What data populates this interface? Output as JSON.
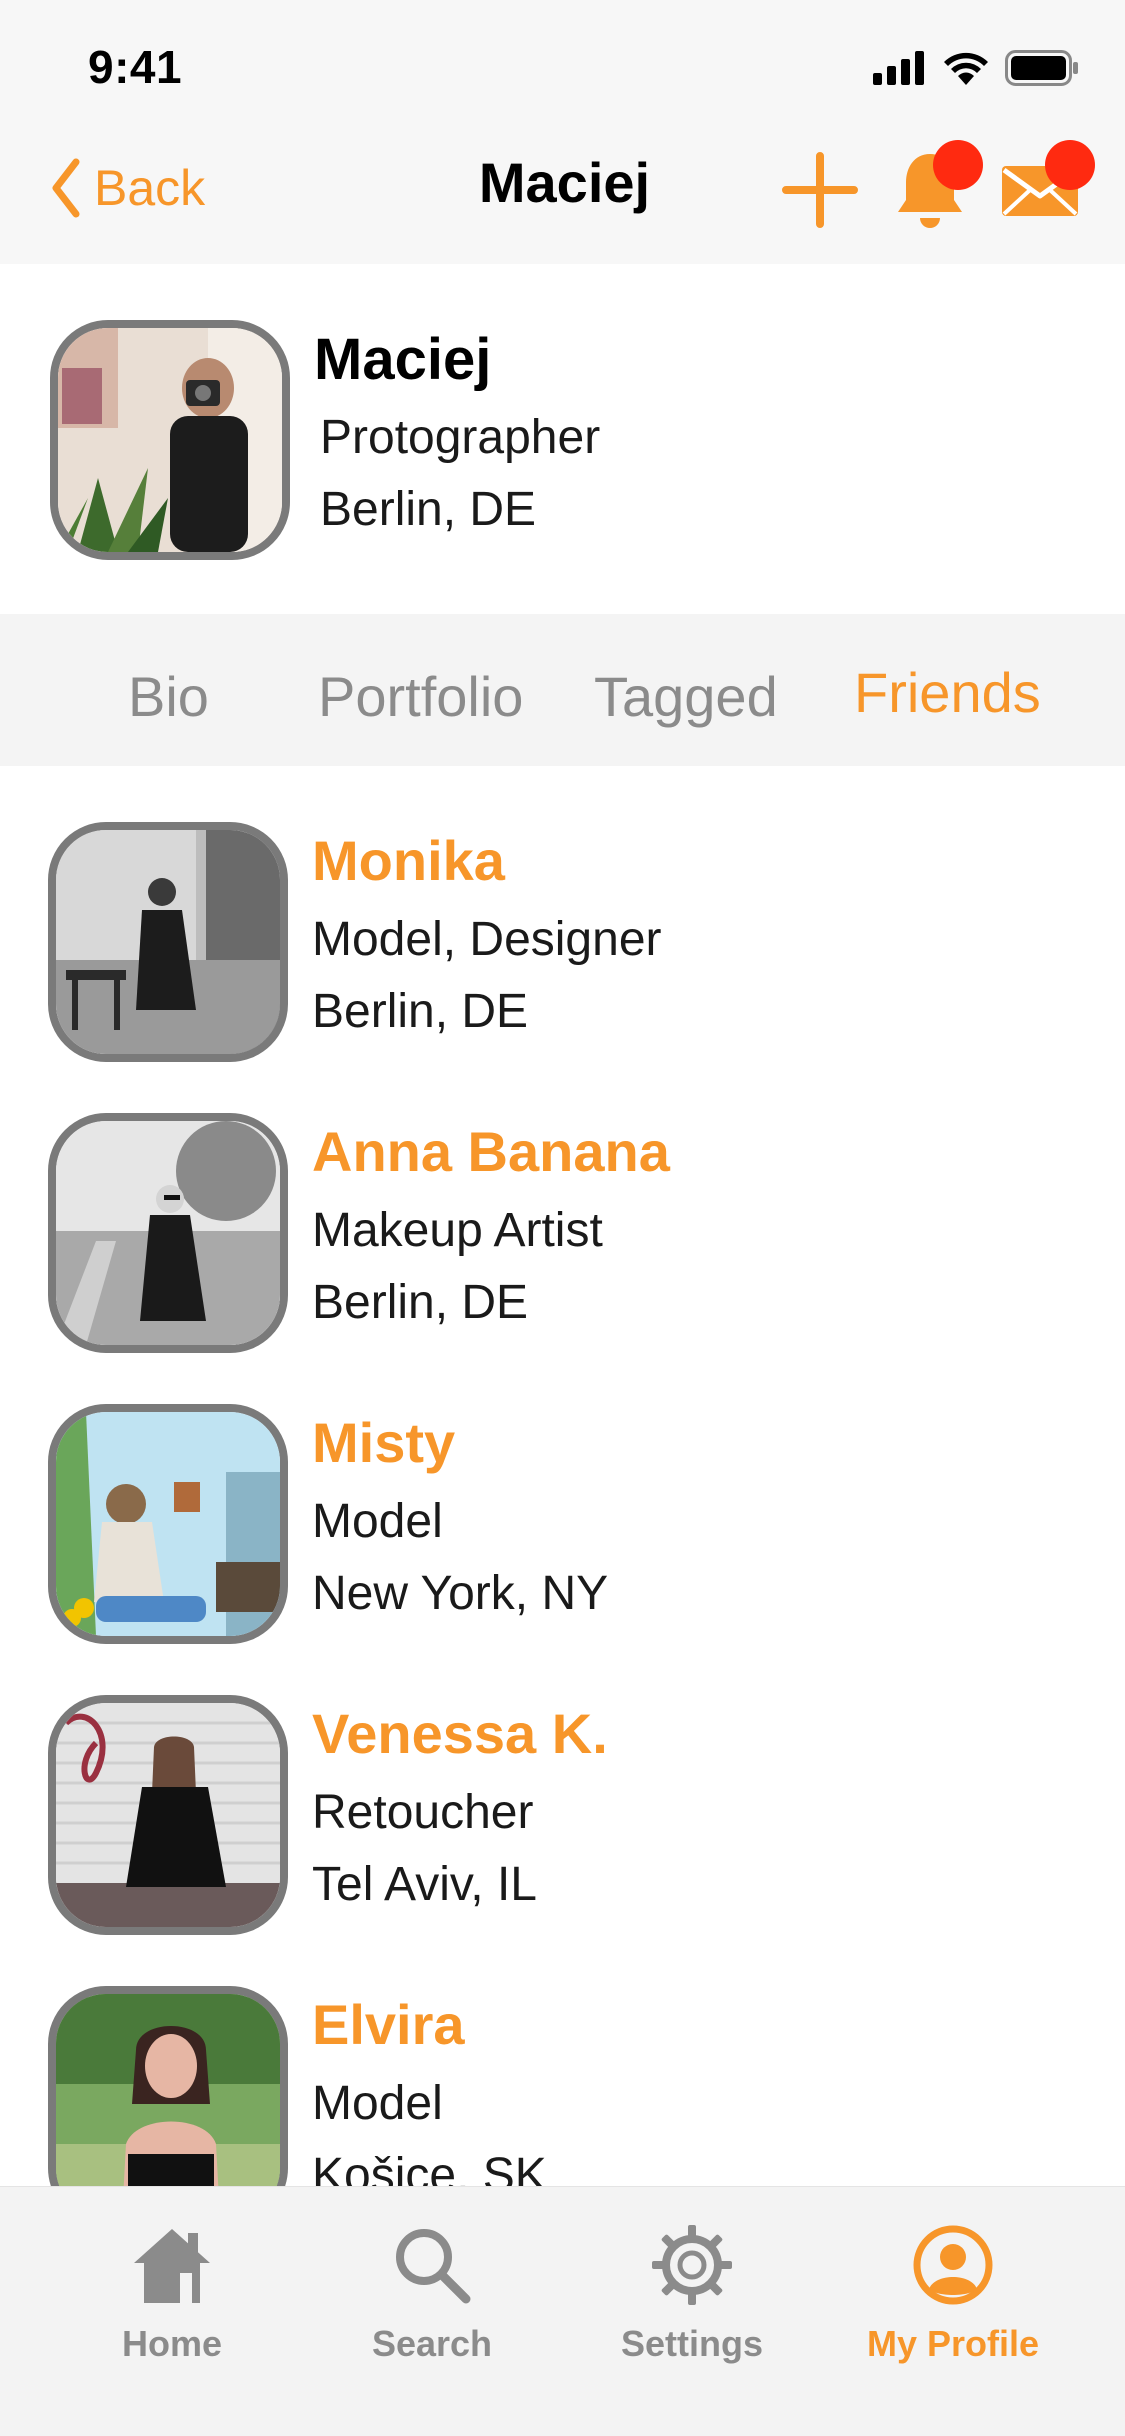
{
  "status_bar": {
    "time": "9:41"
  },
  "nav": {
    "back_label": "Back",
    "title": "Maciej",
    "accent_color": "#f7962a",
    "badge_color": "#ff2a10"
  },
  "profile": {
    "name": "Maciej",
    "profession": "Protographer",
    "location": "Berlin, DE"
  },
  "tabs": [
    {
      "label": "Bio",
      "active": false
    },
    {
      "label": "Portfolio",
      "active": false
    },
    {
      "label": "Tagged",
      "active": false
    },
    {
      "label": "Friends",
      "active": true
    }
  ],
  "friends": [
    {
      "name": "Monika",
      "role": "Model, Designer",
      "location": "Berlin, DE"
    },
    {
      "name": "Anna Banana",
      "role": "Makeup Artist",
      "location": "Berlin, DE"
    },
    {
      "name": "Misty",
      "role": "Model",
      "location": "New York, NY"
    },
    {
      "name": "Venessa K.",
      "role": "Retoucher",
      "location": "Tel Aviv, IL"
    },
    {
      "name": "Elvira",
      "role": "Model",
      "location": "Košice, SK"
    }
  ],
  "tabbar": {
    "items": [
      {
        "label": "Home",
        "icon": "home-icon",
        "active": false
      },
      {
        "label": "Search",
        "icon": "search-icon",
        "active": false
      },
      {
        "label": "Settings",
        "icon": "gear-icon",
        "active": false
      },
      {
        "label": "My Profile",
        "icon": "profile-icon",
        "active": true
      }
    ]
  }
}
